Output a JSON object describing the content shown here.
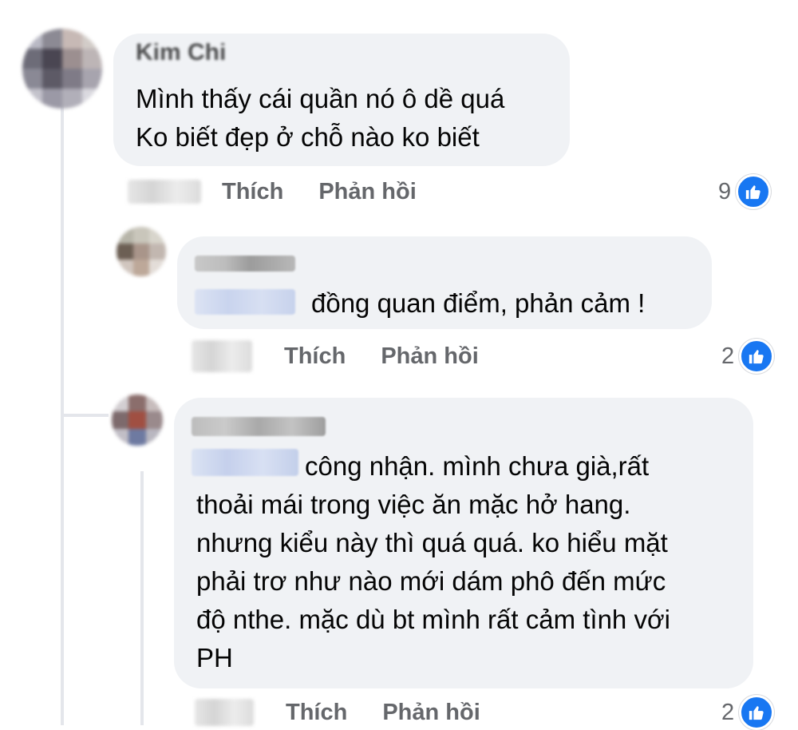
{
  "comments": [
    {
      "author": "Kim Chi",
      "text": "Mình thấy cái quần nó ô dề quá\nKo biết đẹp ở chỗ nào ko biết",
      "like_label": "Thích",
      "reply_label": "Phản hồi",
      "reaction_count": "9"
    }
  ],
  "replies": [
    {
      "text": "đồng quan điểm, phản cảm !",
      "like_label": "Thích",
      "reply_label": "Phản hồi",
      "reaction_count": "2"
    },
    {
      "text": "công nhận. mình chưa già,rất\nthoải mái trong việc ăn mặc hở hang.\nnhưng kiểu này thì quá quá. ko hiểu mặt\nphải trơ như nào mới dám phô đến mức\nđộ nthe. mặc dù bt mình rất cảm tình với\nPH",
      "like_label": "Thích",
      "reply_label": "Phản hồi",
      "reaction_count": "2"
    }
  ],
  "colors": {
    "bubble": "#f0f2f5",
    "action_text": "#65676b",
    "like_blue": "#1877f2"
  },
  "icons": {
    "reaction": "like-icon"
  }
}
